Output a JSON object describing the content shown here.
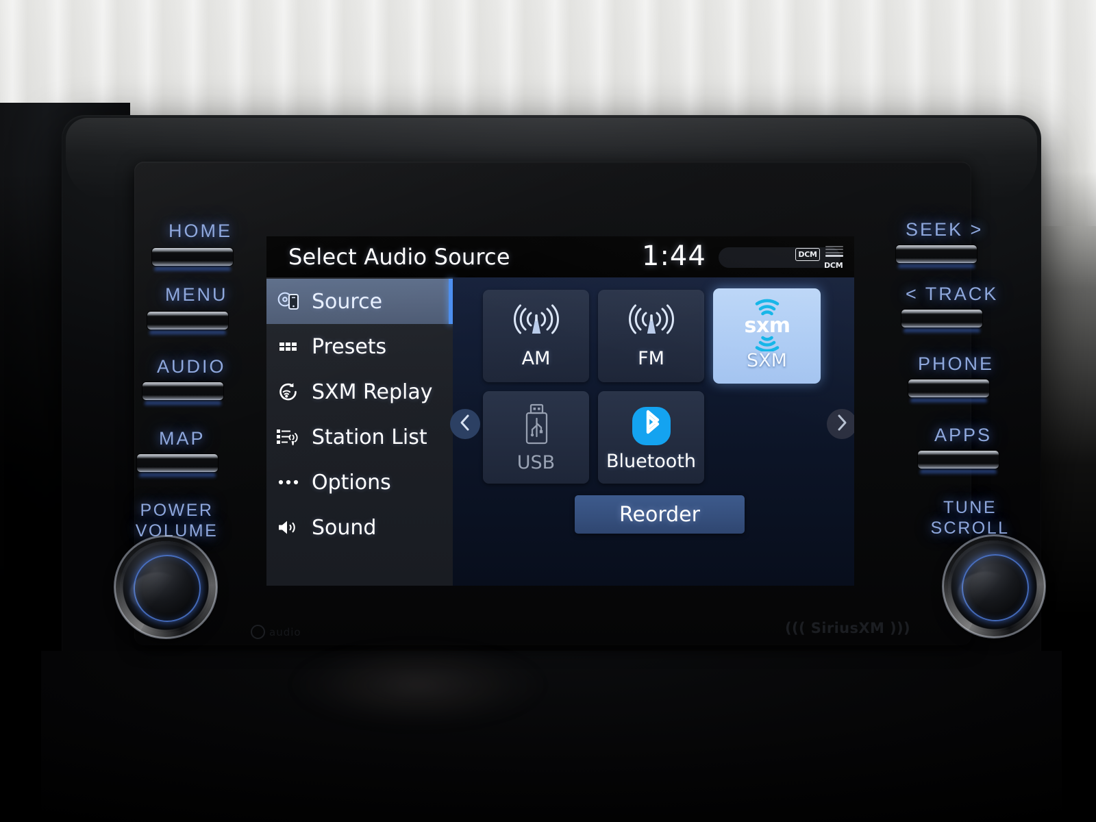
{
  "screen": {
    "status_bar": {
      "title": "Select Audio Source",
      "clock": "1:44",
      "dcm_badge": "DCM",
      "signal_label": "DCM"
    },
    "sidebar": {
      "items": [
        {
          "label": "Source",
          "icon": "source-disc-phone-icon",
          "selected": true
        },
        {
          "label": "Presets",
          "icon": "grid-dots-icon",
          "selected": false
        },
        {
          "label": "SXM Replay",
          "icon": "replay-circle-icon",
          "selected": false
        },
        {
          "label": "Station List",
          "icon": "station-list-antenna-icon",
          "selected": false
        },
        {
          "label": "Options",
          "icon": "ellipsis-icon",
          "selected": false
        },
        {
          "label": "Sound",
          "icon": "speaker-waves-icon",
          "selected": false
        }
      ]
    },
    "sources": [
      {
        "label": "AM",
        "icon": "radio-antenna-icon",
        "state": "normal"
      },
      {
        "label": "FM",
        "icon": "radio-antenna-icon",
        "state": "normal"
      },
      {
        "label": "SXM",
        "icon": "sxm-logo-icon",
        "state": "selected"
      },
      {
        "label": "USB",
        "icon": "usb-stick-icon",
        "state": "disabled"
      },
      {
        "label": "Bluetooth",
        "icon": "bluetooth-icon",
        "state": "normal"
      }
    ],
    "pagination": {
      "prev": "chevron-left-icon",
      "next": "chevron-right-icon"
    },
    "reorder_button": "Reorder",
    "sxm_logo_text": "sxm"
  },
  "hard_controls": {
    "left_buttons": [
      "HOME",
      "MENU",
      "AUDIO",
      "MAP"
    ],
    "right_buttons": [
      "SEEK >",
      "< TRACK",
      "PHONE",
      "APPS"
    ],
    "left_knob": {
      "line1": "POWER",
      "line2": "VOLUME"
    },
    "right_knob": {
      "line1": "TUNE",
      "line2": "SCROLL"
    }
  },
  "bezel": {
    "sirius_brand": "((( SiriusXM )))",
    "audio_brand": "audio"
  },
  "colors": {
    "accent_blue": "#4b8ef0",
    "backlight_blue": "#8fa8dd",
    "selected_tile": "#aeccf4",
    "bluetooth_blue": "#14a3f0",
    "sxm_cyan": "#13b5e8"
  }
}
